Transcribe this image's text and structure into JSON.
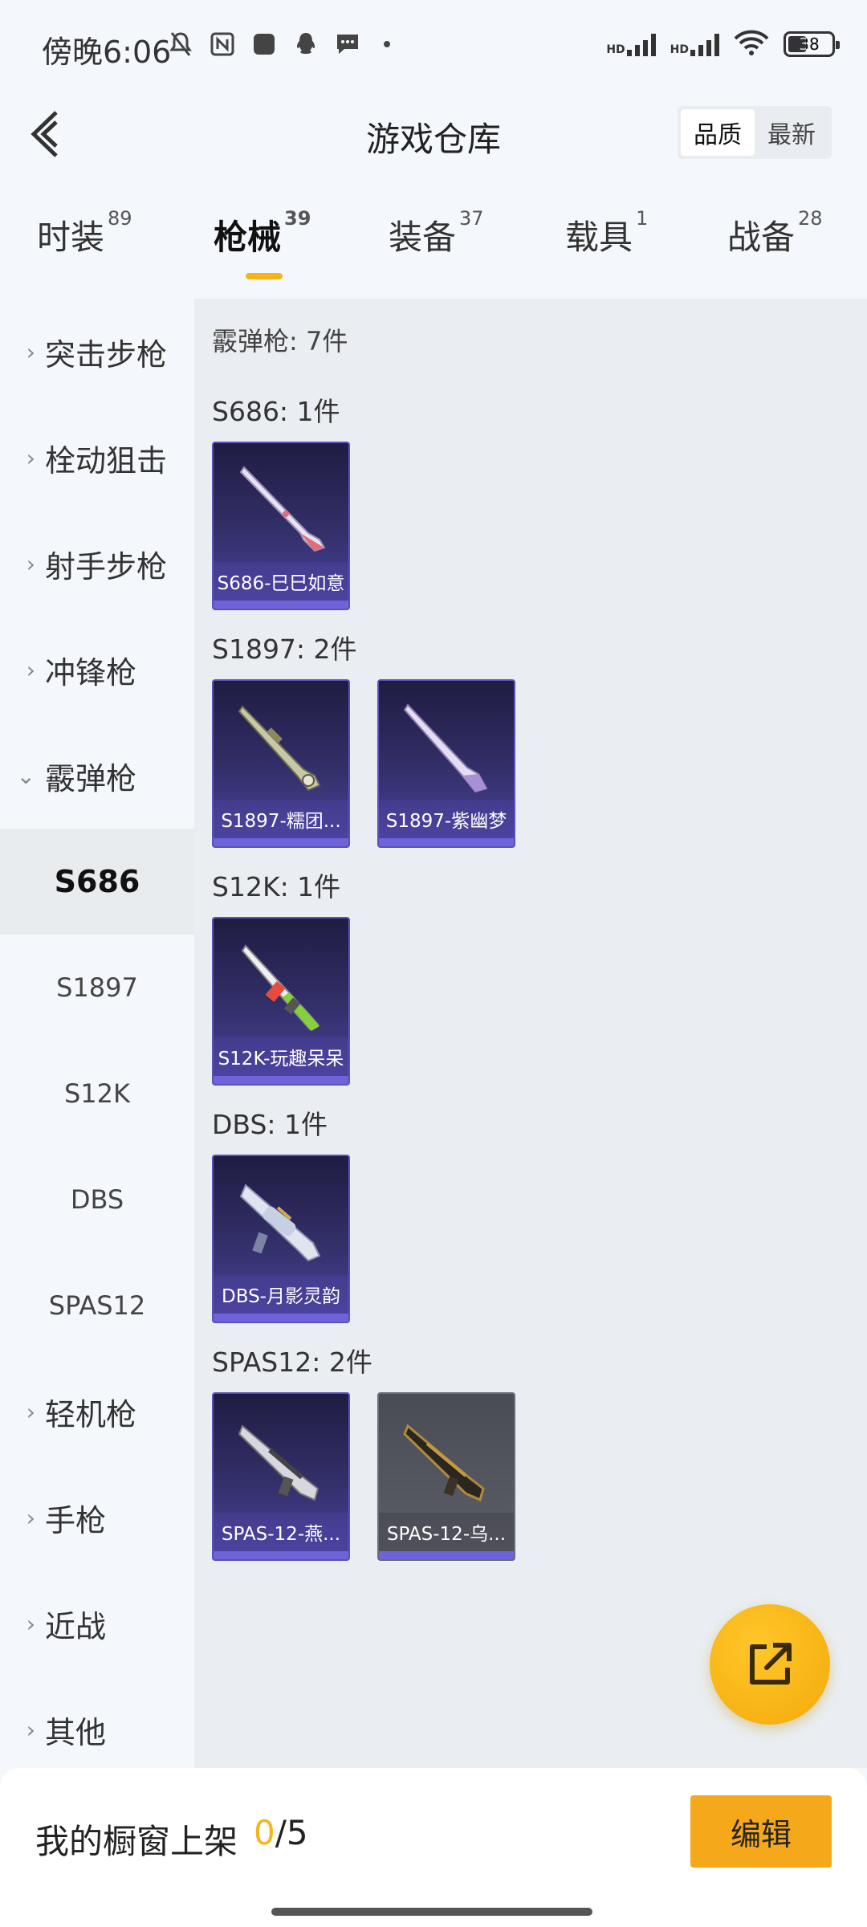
{
  "status_bar": {
    "time": "傍晚6:06",
    "battery": "38",
    "network_badge": "HD"
  },
  "header": {
    "title": "游戏仓库",
    "sort_options": [
      "品质",
      "最新"
    ],
    "active_sort": "品质"
  },
  "tabs": [
    {
      "label": "时装",
      "count": "89",
      "active": false
    },
    {
      "label": "枪械",
      "count": "39",
      "active": true
    },
    {
      "label": "装备",
      "count": "37",
      "active": false
    },
    {
      "label": "载具",
      "count": "1",
      "active": false
    },
    {
      "label": "战备",
      "count": "28",
      "active": false
    }
  ],
  "sidebar": {
    "categories": [
      "突击步枪",
      "栓动狙击",
      "射手步枪",
      "冲锋枪",
      "霰弹枪",
      "轻机枪",
      "手枪",
      "近战",
      "其他"
    ],
    "expanded": "霰弹枪",
    "subitems": [
      "S686",
      "S1897",
      "S12K",
      "DBS",
      "SPAS12"
    ],
    "active_sub": "S686"
  },
  "content": {
    "group_title": "霰弹枪: 7件",
    "sections": [
      {
        "label": "S686: 1件",
        "items": [
          {
            "name": "S686-巳巳如意",
            "style": "purple"
          }
        ]
      },
      {
        "label": "S1897: 2件",
        "items": [
          {
            "name": "S1897-糯团...",
            "style": "purple"
          },
          {
            "name": "S1897-紫幽梦",
            "style": "purple"
          }
        ]
      },
      {
        "label": "S12K: 1件",
        "items": [
          {
            "name": "S12K-玩趣呆呆",
            "style": "purple"
          }
        ]
      },
      {
        "label": "DBS: 1件",
        "items": [
          {
            "name": "DBS-月影灵韵",
            "style": "purple"
          }
        ]
      },
      {
        "label": "SPAS12: 2件",
        "items": [
          {
            "name": "SPAS-12-燕...",
            "style": "purple"
          },
          {
            "name": "SPAS-12-乌...",
            "style": "gray"
          }
        ]
      }
    ]
  },
  "bottom_bar": {
    "showcase_label": "我的橱窗上架",
    "showcase_current": "0",
    "showcase_total": "/5",
    "edit_label": "编辑"
  },
  "colors": {
    "accent": "#f5b418",
    "card_purple": "#34306b",
    "card_gray": "#5d5f68",
    "fab": "#f4a90a"
  },
  "icons": {
    "back": "chevron-left-icon",
    "share": "external-link-icon",
    "sidebar_collapsed": "chevron-right-icon",
    "sidebar_expanded": "chevron-down-icon"
  }
}
